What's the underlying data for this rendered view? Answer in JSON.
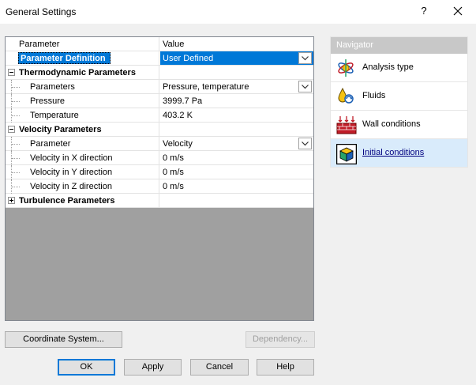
{
  "window": {
    "title": "General Settings",
    "help_glyph": "?"
  },
  "grid": {
    "col_param": "Parameter",
    "col_value": "Value",
    "rows": [
      {
        "label": "Parameter Definition",
        "value": "User Defined"
      },
      {
        "label": "Thermodynamic Parameters",
        "value": ""
      },
      {
        "label": "Parameters",
        "value": "Pressure, temperature"
      },
      {
        "label": "Pressure",
        "value": "3999.7 Pa"
      },
      {
        "label": "Temperature",
        "value": "403.2 K"
      },
      {
        "label": "Velocity Parameters",
        "value": ""
      },
      {
        "label": "Parameter",
        "value": "Velocity"
      },
      {
        "label": "Velocity in X direction",
        "value": "0 m/s"
      },
      {
        "label": "Velocity in Y direction",
        "value": "0 m/s"
      },
      {
        "label": "Velocity in Z direction",
        "value": "0 m/s"
      },
      {
        "label": "Turbulence Parameters",
        "value": ""
      }
    ]
  },
  "navigator": {
    "title": "Navigator",
    "items": [
      {
        "label": "Analysis type",
        "icon": "analysis-type-icon"
      },
      {
        "label": "Fluids",
        "icon": "fluids-icon"
      },
      {
        "label": "Wall conditions",
        "icon": "wall-conditions-icon"
      },
      {
        "label": "Initial conditions",
        "icon": "initial-conditions-icon",
        "active": true
      }
    ]
  },
  "buttons": {
    "coordinate_system": "Coordinate System...",
    "dependency": "Dependency...",
    "ok": "OK",
    "apply": "Apply",
    "cancel": "Cancel",
    "help": "Help"
  },
  "colors": {
    "selection": "#0078d7",
    "navigator_header": "#c8c8c8",
    "navigator_active": "#d9ebfb",
    "grid_empty_area": "#a0a0a0"
  }
}
